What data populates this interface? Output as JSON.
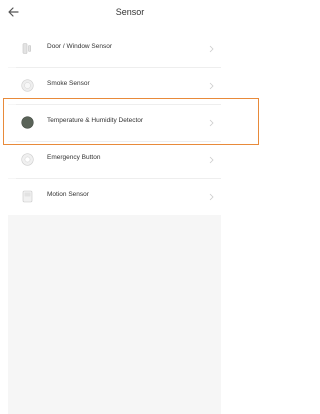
{
  "header": {
    "title": "Sensor",
    "back_icon": "arrow-left-icon"
  },
  "items": [
    {
      "label": "Door / Window Sensor",
      "icon": "door-window-sensor-icon"
    },
    {
      "label": "Smoke Sensor",
      "icon": "smoke-sensor-icon"
    },
    {
      "label": "Temperature & Humidity Detector",
      "icon": "temperature-humidity-detector-icon",
      "highlighted": true
    },
    {
      "label": "Emergency Button",
      "icon": "emergency-button-icon"
    },
    {
      "label": "Motion Sensor",
      "icon": "motion-sensor-icon"
    }
  ],
  "colors": {
    "highlight_border": "#e88a3a",
    "list_background": "#f6f6f6",
    "chevron": "#cccccc"
  }
}
